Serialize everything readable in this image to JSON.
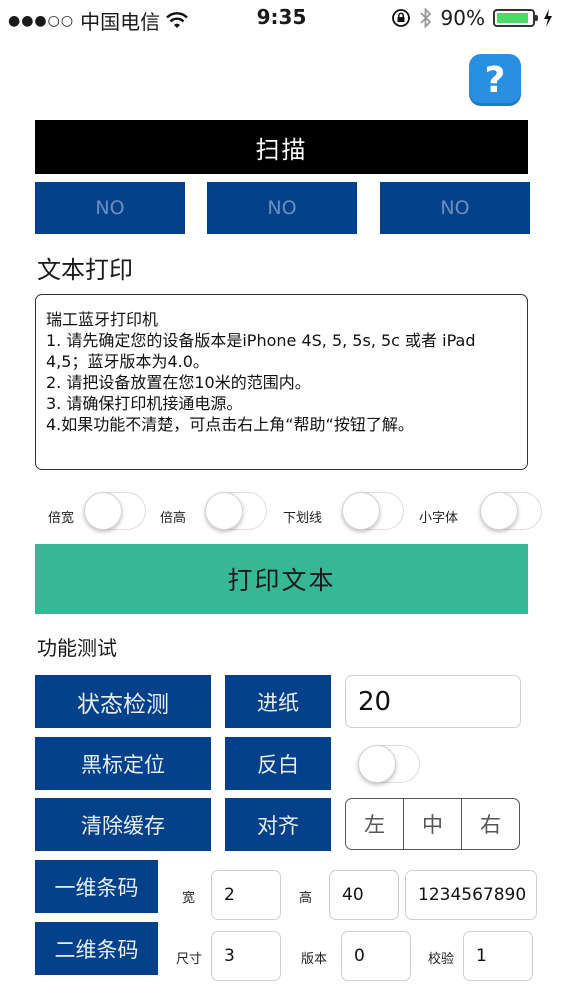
{
  "status_bar": {
    "signal": "●●●○○",
    "carrier": "中国电信",
    "time": "9:35",
    "battery": "90%",
    "battery_level": 0.9,
    "wifi_icon": "wifi-icon",
    "lock_icon": "rotation-lock-icon",
    "bluetooth_icon": "bluetooth-icon"
  },
  "help_label": "?",
  "scan_label": "扫描",
  "devices": [
    "NO",
    "NO",
    "NO"
  ],
  "text_print": {
    "title": "文本打印",
    "content": "瑞工蓝牙打印机\n1. 请先确定您的设备版本是iPhone 4S, 5, 5s, 5c 或者 iPad 4,5；蓝牙版本为4.0。\n2. 请把设备放置在您10米的范围内。\n3. 请确保打印机接通电源。\n4.如果功能不清楚，可点击右上角“帮助“按钮了解。",
    "options": [
      {
        "label": "倍宽",
        "on": false
      },
      {
        "label": "倍高",
        "on": false
      },
      {
        "label": "下划线",
        "on": false
      },
      {
        "label": "小字体",
        "on": false
      }
    ],
    "print_button": "打印文本"
  },
  "func_test": {
    "title": "功能测试",
    "status_check": "状态检测",
    "feed": "进纸",
    "feed_value": "20",
    "black_mark": "黑标定位",
    "invert": "反白",
    "invert_on": false,
    "clear_buffer": "清除缓存",
    "align": "对齐",
    "align_options": [
      "左",
      "中",
      "右"
    ]
  },
  "barcode": {
    "button": "一维条码",
    "width_label": "宽",
    "width_value": "2",
    "height_label": "高",
    "height_value": "40",
    "data_value": "1234567890"
  },
  "qrcode": {
    "button": "二维条码",
    "size_label": "尺寸",
    "size_value": "3",
    "version_label": "版本",
    "version_value": "0",
    "ecc_label": "校验",
    "ecc_value": "1"
  },
  "colors": {
    "primary_blue": "#05418a",
    "print_green": "#36b897",
    "scan_black": "#000000",
    "help_blue": "#2a8fe0"
  }
}
